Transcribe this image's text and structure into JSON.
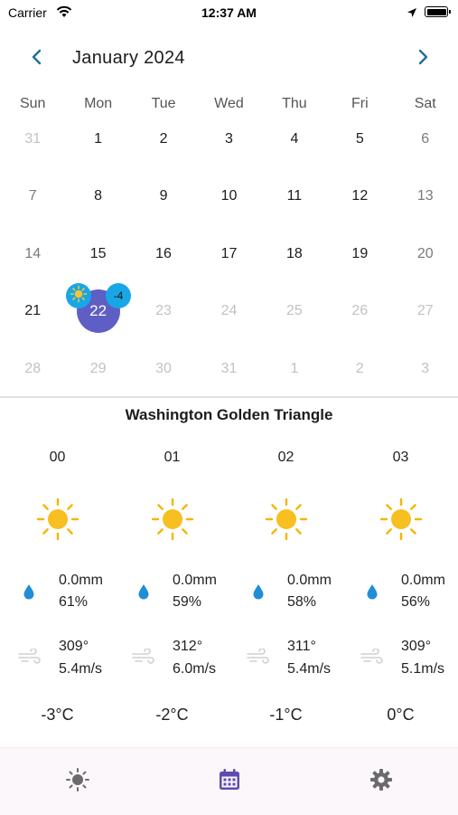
{
  "status_bar": {
    "carrier": "Carrier",
    "time": "12:37 AM",
    "wifi_icon": "wifi-icon",
    "location_icon": "location-arrow-icon",
    "battery_icon": "battery-icon"
  },
  "calendar": {
    "month_title": "January 2024",
    "prev_icon": "chevron-left-icon",
    "next_icon": "chevron-right-icon",
    "weekdays": [
      "Sun",
      "Mon",
      "Tue",
      "Wed",
      "Thu",
      "Fri",
      "Sat"
    ],
    "weeks": [
      [
        "31",
        "1",
        "2",
        "3",
        "4",
        "5",
        "6"
      ],
      [
        "7",
        "8",
        "9",
        "10",
        "11",
        "12",
        "13"
      ],
      [
        "14",
        "15",
        "16",
        "17",
        "18",
        "19",
        "20"
      ],
      [
        "21",
        "22",
        "23",
        "24",
        "25",
        "26",
        "27"
      ],
      [
        "28",
        "29",
        "30",
        "31",
        "1",
        "2",
        "3"
      ]
    ],
    "selected_day": "22",
    "selected_badge_icon": "sun-icon",
    "selected_badge_temp": "-4",
    "colors": {
      "accent": "#5e5ec4",
      "badge": "#19a6e6"
    }
  },
  "forecast": {
    "location": "Washington Golden Triangle",
    "hours": [
      {
        "hour": "00",
        "icon": "sun-icon",
        "precip": "0.0mm",
        "humidity": "61%",
        "wind_dir": "309°",
        "wind_speed": "5.4m/s",
        "temp": "-3°C"
      },
      {
        "hour": "01",
        "icon": "sun-icon",
        "precip": "0.0mm",
        "humidity": "59%",
        "wind_dir": "312°",
        "wind_speed": "6.0m/s",
        "temp": "-2°C"
      },
      {
        "hour": "02",
        "icon": "sun-icon",
        "precip": "0.0mm",
        "humidity": "58%",
        "wind_dir": "311°",
        "wind_speed": "5.4m/s",
        "temp": "-1°C"
      },
      {
        "hour": "03",
        "icon": "sun-icon",
        "precip": "0.0mm",
        "humidity": "56%",
        "wind_dir": "309°",
        "wind_speed": "5.1m/s",
        "temp": "0°C"
      }
    ],
    "drop_icon": "water-drop-icon",
    "wind_icon": "wind-icon"
  },
  "tabbar": {
    "tabs": [
      {
        "icon": "sun-icon",
        "active": false
      },
      {
        "icon": "calendar-icon",
        "active": true
      },
      {
        "icon": "gear-icon",
        "active": false
      }
    ],
    "colors": {
      "active": "#5e4bb0",
      "inactive": "#6b6b6f"
    }
  }
}
